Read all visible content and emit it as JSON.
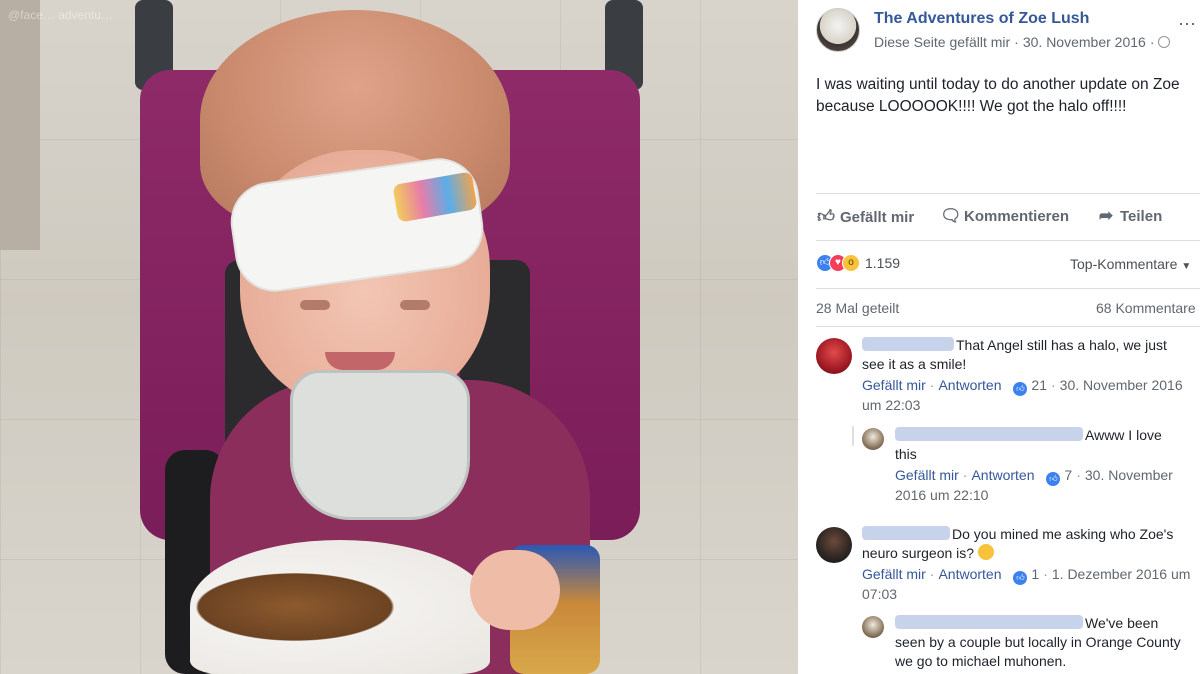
{
  "photo": {
    "watermark": "@face… adventu…"
  },
  "post": {
    "page_name": "The Adventures of Zoe Lush",
    "like_page_label": "Diese Seite gefällt mir",
    "date": "30. November 2016",
    "text": "I was waiting until today to do another update on Zoe because LOOOOOK!!!! We got the halo off!!!!",
    "more_icon": "⋯"
  },
  "actions": {
    "like": "Gefällt mir",
    "comment": "Kommentieren",
    "share": "Teilen"
  },
  "stats": {
    "reaction_count": "1.159",
    "top_comments": "Top-Kommentare",
    "shares": "28 Mal geteilt",
    "comments": "68 Kommentare"
  },
  "comments": [
    {
      "text": "That Angel still has a halo, we just see it as a smile!",
      "like": "Gefällt mir",
      "reply": "Antworten",
      "likes": "21",
      "time": "30. November 2016 um 22:03"
    },
    {
      "text": "Awww I love this",
      "like": "Gefällt mir",
      "reply": "Antworten",
      "likes": "7",
      "time": "30. November 2016 um 22:10"
    },
    {
      "text": "Do you mined me asking who Zoe's neuro surgeon is?",
      "like": "Gefällt mir",
      "reply": "Antworten",
      "likes": "1",
      "time": "1. Dezember 2016 um 07:03"
    },
    {
      "text": "We've been seen by a couple but locally in Orange County we go to michael muhonen."
    }
  ],
  "colors": {
    "link": "#365899",
    "like_blue": "#3b82f0",
    "love_red": "#f33e58",
    "wow_yellow": "#f7c33b"
  }
}
